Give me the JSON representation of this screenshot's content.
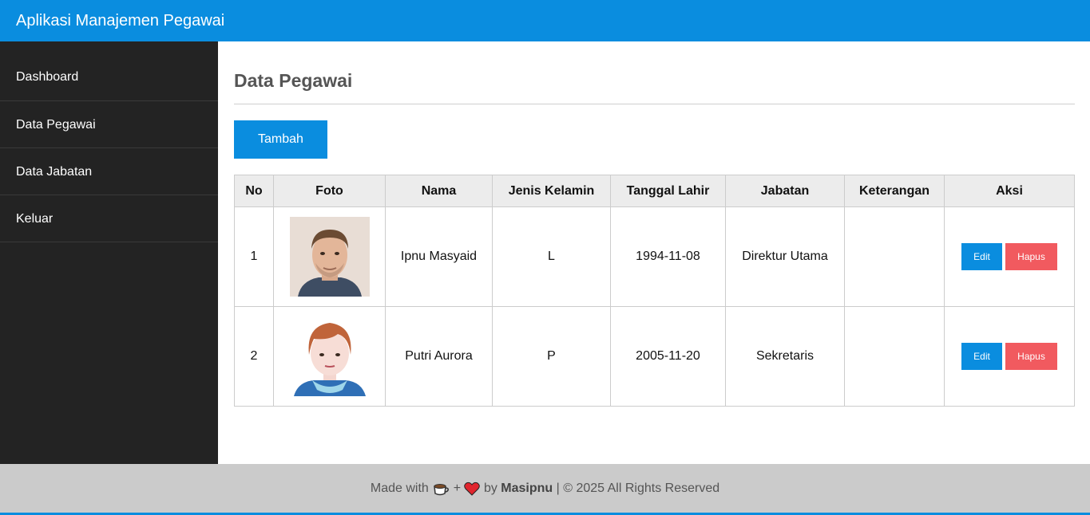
{
  "app": {
    "title": "Aplikasi Manajemen Pegawai"
  },
  "sidebar": {
    "items": [
      {
        "label": "Dashboard"
      },
      {
        "label": "Data Pegawai"
      },
      {
        "label": "Data Jabatan"
      },
      {
        "label": "Keluar"
      }
    ]
  },
  "main": {
    "title": "Data Pegawai",
    "add_label": "Tambah",
    "table": {
      "headers": [
        "No",
        "Foto",
        "Nama",
        "Jenis Kelamin",
        "Tanggal Lahir",
        "Jabatan",
        "Keterangan",
        "Aksi"
      ],
      "rows": [
        {
          "no": "1",
          "photo": "male-photo",
          "nama": "Ipnu Masyaid",
          "jk": "L",
          "tgl": "1994-11-08",
          "jabatan": "Direktur Utama",
          "keterangan": "",
          "edit": "Edit",
          "hapus": "Hapus"
        },
        {
          "no": "2",
          "photo": "female-avatar",
          "nama": "Putri Aurora",
          "jk": "P",
          "tgl": "2005-11-20",
          "jabatan": "Sekretaris",
          "keterangan": "",
          "edit": "Edit",
          "hapus": "Hapus"
        }
      ]
    }
  },
  "footer": {
    "made_with": "Made with",
    "plus": "+",
    "by": "by",
    "author": "Masipnu",
    "rights": "| © 2025 All Rights Reserved",
    "icons": [
      "coffee-icon",
      "heart-icon"
    ]
  },
  "colors": {
    "primary": "#0a8ddf",
    "danger": "#f15a5f",
    "sidebar": "#232323",
    "footer": "#cbcbcb"
  }
}
